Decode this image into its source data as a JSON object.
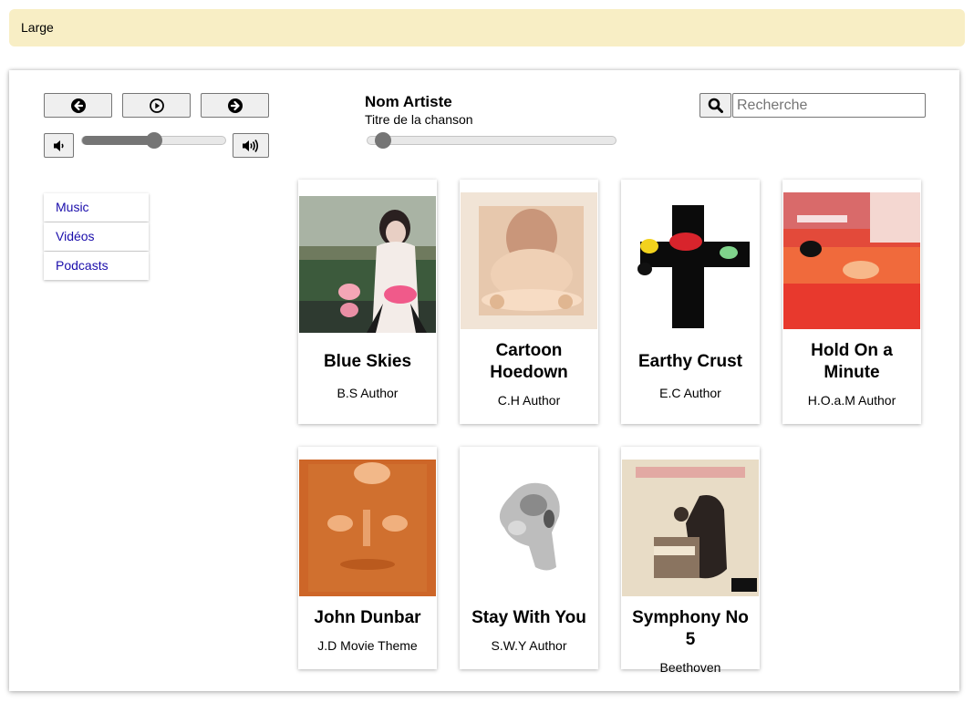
{
  "banner": {
    "label": "Large"
  },
  "player": {
    "artist": "Nom Artiste",
    "song": "Titre de la chanson",
    "volume_percent": 50,
    "progress_percent": 0
  },
  "search": {
    "placeholder": "Recherche",
    "value": ""
  },
  "nav": {
    "items": [
      {
        "label": "Music"
      },
      {
        "label": "Vidéos"
      },
      {
        "label": "Podcasts"
      }
    ]
  },
  "albums": [
    {
      "title": "Blue Skies",
      "author": "B.S Author"
    },
    {
      "title": "Cartoon Hoedown",
      "author": "C.H Author"
    },
    {
      "title": "Earthy Crust",
      "author": "E.C Author"
    },
    {
      "title": "Hold On a Minute",
      "author": "H.O.a.M Author"
    },
    {
      "title": "John Dunbar",
      "author": "J.D Movie Theme"
    },
    {
      "title": "Stay With You",
      "author": "S.W.Y Author"
    },
    {
      "title": "Symphony No 5",
      "author": "Beethoven"
    }
  ],
  "colors": {
    "banner": "#f8eec5",
    "link": "#1a0dab",
    "slider": "#757575"
  }
}
